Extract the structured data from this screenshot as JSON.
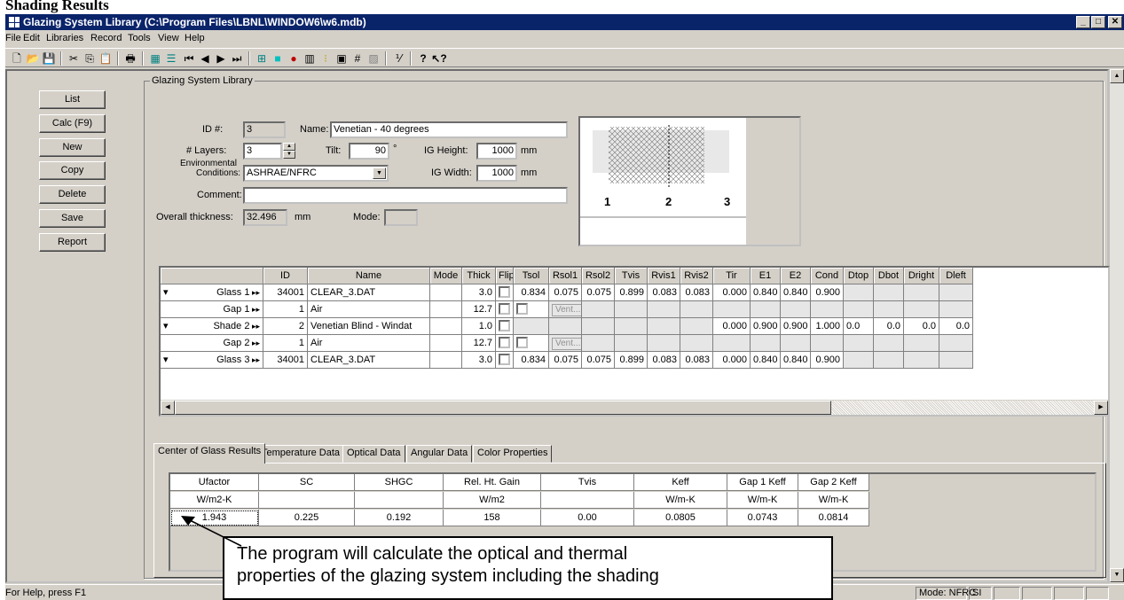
{
  "heading": "Shading Results",
  "window": {
    "title": "Glazing System Library (C:\\Program Files\\LBNL\\WINDOW6\\w6.mdb)"
  },
  "menu": [
    "File",
    "Edit",
    "Libraries",
    "Record",
    "Tools",
    "View",
    "Help"
  ],
  "buttons": [
    "List",
    "Calc (F9)",
    "New",
    "Copy",
    "Delete",
    "Save",
    "Report"
  ],
  "group_title": "Glazing System Library",
  "form": {
    "id_label": "ID #:",
    "id": "3",
    "name_label": "Name:",
    "name": "Venetian - 40 degrees",
    "layers_label": "# Layers:",
    "layers": "3",
    "tilt_label": "Tilt:",
    "tilt": "90",
    "tilt_unit": "°",
    "igh_label": "IG Height:",
    "ig_height": "1000",
    "ig_height_unit": "mm",
    "env_label_1": "Environmental",
    "env_label_2": "Conditions:",
    "env": "ASHRAE/NFRC",
    "igw_label": "IG Width:",
    "ig_width": "1000",
    "ig_width_unit": "mm",
    "comment_label": "Comment:",
    "comment": "",
    "thick_label": "Overall thickness:",
    "thickness": "32.496",
    "thickness_unit": "mm",
    "mode_label": "Mode:",
    "mode": ""
  },
  "preview_numbers": [
    "1",
    "2",
    "3"
  ],
  "grid": {
    "columns": [
      "ID",
      "Name",
      "Mode",
      "Thick",
      "Flip",
      "Tsol",
      "Rsol1",
      "Rsol2",
      "Tvis",
      "Rvis1",
      "Rvis2",
      "Tir",
      "E1",
      "E2",
      "Cond",
      "Dtop",
      "Dbot",
      "Dright",
      "Dleft"
    ],
    "rows": [
      {
        "label": "Glass 1",
        "id": "34001",
        "name": "CLEAR_3.DAT",
        "thick": "3.0",
        "tsol": "0.834",
        "rsol1": "0.075",
        "rsol2": "0.075",
        "tvis": "0.899",
        "rvis1": "0.083",
        "rvis2": "0.083",
        "tir": "0.000",
        "e1": "0.840",
        "e2": "0.840",
        "cond": "0.900",
        "dtop": "",
        "dbot": "",
        "dright": "",
        "dleft": ""
      },
      {
        "label": "Gap 1",
        "id": "1",
        "name": "Air",
        "thick": "12.7",
        "vent": "Vent..."
      },
      {
        "label": "Shade 2",
        "id": "2",
        "name": "Venetian Blind - Windat",
        "thick": "1.0",
        "tsol": "",
        "rsol1": "",
        "rsol2": "",
        "tvis": "",
        "rvis1": "",
        "rvis2": "",
        "tir": "0.000",
        "e1": "0.900",
        "e2": "0.900",
        "cond": "1.000",
        "dtop": "0.0",
        "dbot": "0.0",
        "dright": "0.0",
        "dleft": "0.0"
      },
      {
        "label": "Gap 2",
        "id": "1",
        "name": "Air",
        "thick": "12.7",
        "vent": "Vent..."
      },
      {
        "label": "Glass 3",
        "id": "34001",
        "name": "CLEAR_3.DAT",
        "thick": "3.0",
        "tsol": "0.834",
        "rsol1": "0.075",
        "rsol2": "0.075",
        "tvis": "0.899",
        "rvis1": "0.083",
        "rvis2": "0.083",
        "tir": "0.000",
        "e1": "0.840",
        "e2": "0.840",
        "cond": "0.900",
        "dtop": "",
        "dbot": "",
        "dright": "",
        "dleft": ""
      }
    ]
  },
  "tabs": [
    "Center of Glass Results",
    "Temperature Data",
    "Optical Data",
    "Angular Data",
    "Color Properties"
  ],
  "results": {
    "headers": [
      "Ufactor",
      "SC",
      "SHGC",
      "Rel. Ht. Gain",
      "Tvis",
      "Keff",
      "Gap 1 Keff",
      "Gap 2 Keff"
    ],
    "units": [
      "W/m2-K",
      "",
      "",
      "W/m2",
      "",
      "W/m-K",
      "W/m-K",
      "W/m-K"
    ],
    "values": [
      "1.943",
      "0.225",
      "0.192",
      "158",
      "0.00",
      "0.0805",
      "0.0743",
      "0.0814"
    ]
  },
  "status": {
    "help": "For Help, press F1",
    "mode": "Mode: NFRC",
    "units": "SI"
  },
  "callout": {
    "line1": "The program will calculate the optical and thermal",
    "line2": "properties of the glazing system including the shading"
  }
}
